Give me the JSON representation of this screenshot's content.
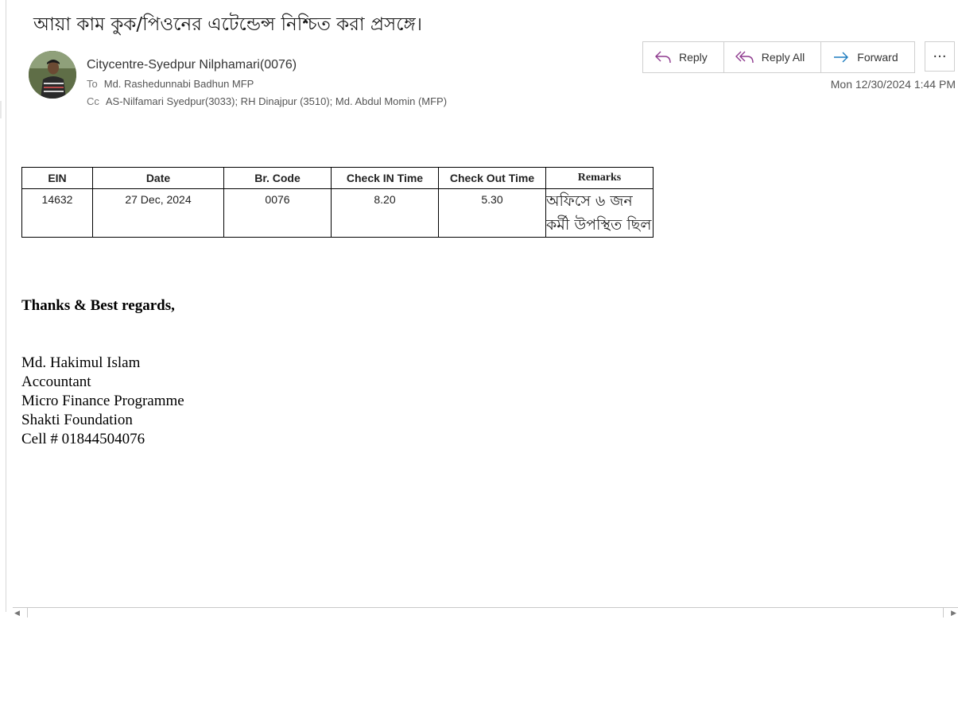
{
  "email": {
    "subject": "আয়া কাম কুক/পিওনের এটেন্ডেন্স নিশ্চিত করা প্রসঙ্গে।",
    "sender": "Citycentre-Syedpur Nilphamari(0076)",
    "to_label": "To",
    "to": "Md. Rashedunnabi Badhun MFP",
    "cc_label": "Cc",
    "cc": "AS-Nilfamari Syedpur(3033); RH Dinajpur (3510); Md. Abdul Momin (MFP)",
    "date": "Mon 12/30/2024 1:44 PM"
  },
  "actions": {
    "reply": "Reply",
    "reply_all": "Reply All",
    "forward": "Forward",
    "more": "···"
  },
  "icons": {
    "reply": "reply-icon",
    "reply_all": "reply-all-icon",
    "forward": "forward-icon",
    "more": "more-icon",
    "accent_reply": "#8e3a8e",
    "accent_forward": "#1c7bbf"
  },
  "table": {
    "headers": [
      "EIN",
      "Date",
      "Br. Code",
      "Check IN Time",
      "Check Out Time",
      "Remarks"
    ],
    "row": {
      "ein": "14632",
      "date": "27 Dec, 2024",
      "br_code": "0076",
      "check_in": "8.20",
      "check_out": "5.30",
      "remarks_line1": "অফিসে ৬ জন",
      "remarks_line2": "কর্মী উপস্থিত ছিল"
    }
  },
  "signature": {
    "regards": "Thanks & Best regards,",
    "name": "Md. Hakimul Islam",
    "title": "Accountant",
    "program": "Micro Finance Programme",
    "org": "Shakti Foundation",
    "cell": "Cell # 01844504076"
  }
}
